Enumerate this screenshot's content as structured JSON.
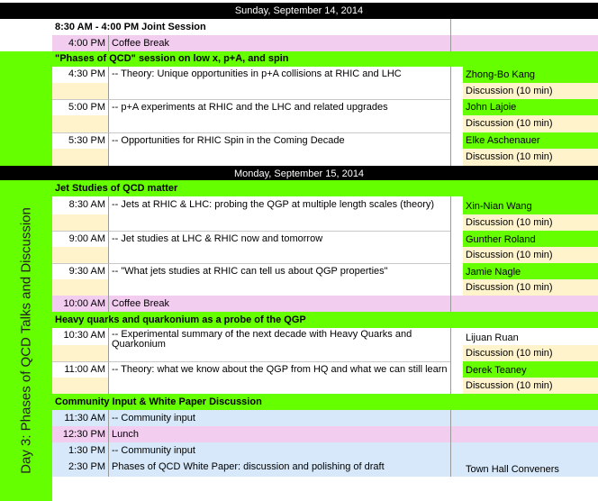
{
  "day1": {
    "header": "Sunday, September 14, 2014",
    "joint_session": "8:30 AM - 4:00 PM Joint Session",
    "break_time": "4:00 PM",
    "break_label": "Coffee Break",
    "session_title": "\"Phases of QCD\" session on low x, p+A, and spin",
    "talks": [
      {
        "time": "4:30 PM",
        "title": "-- Theory: Unique opportunities in p+A collisions at RHIC and LHC",
        "speaker": "Zhong-Bo Kang",
        "discussion": "Discussion (10 min)"
      },
      {
        "time": "5:00 PM",
        "title": "-- p+A experiments at RHIC and the LHC and related upgrades",
        "speaker": "John Lajoie",
        "discussion": "Discussion (10 min)"
      },
      {
        "time": "5:30 PM",
        "title": "-- Opportunities for RHIC Spin in the Coming Decade",
        "speaker": "Elke Aschenauer",
        "discussion": "Discussion (10 min)"
      }
    ]
  },
  "day2": {
    "header": "Monday, September 15, 2014",
    "side_label": "Day 3: Phases of QCD Talks and Discussion",
    "jet_session": "Jet Studies of QCD matter",
    "jet_talks": [
      {
        "time": "8:30 AM",
        "title": "-- Jets at RHIC & LHC: probing the QGP at multiple length scales (theory)",
        "speaker": "Xin-Nian Wang",
        "discussion": "Discussion (10 min)"
      },
      {
        "time": "9:00 AM",
        "title": "-- Jet studies at LHC & RHIC now and tomorrow",
        "speaker": "Gunther Roland",
        "discussion": "Discussion (10 min)"
      },
      {
        "time": "9:30 AM",
        "title": "-- \"What jets studies at RHIC can tell us about QGP properties\"",
        "speaker": "Jamie Nagle",
        "discussion": "Discussion (10 min)"
      }
    ],
    "break_time": "10:00 AM",
    "break_label": "Coffee Break",
    "hq_session": "Heavy quarks and quarkonium as a probe of the QGP",
    "hq_talks": [
      {
        "time": "10:30 AM",
        "title_line1": "-- Experimental summary of the next decade with Heavy Quarks and",
        "title_line2": "Quarkonium",
        "speaker": "Lijuan Ruan",
        "discussion": "Discussion (10 min)"
      },
      {
        "time": "11:00 AM",
        "title": "-- Theory: what we know about the QGP from HQ and what we can still learn",
        "speaker": "Derek Teaney",
        "discussion": "Discussion (10 min)"
      }
    ],
    "community_session": "Community Input & White Paper Discussion",
    "community": [
      {
        "time": "11:30 AM",
        "title": "-- Community input",
        "color": "blue",
        "speaker": ""
      },
      {
        "time": "12:30 PM",
        "title": "Lunch",
        "color": "pink",
        "speaker": ""
      },
      {
        "time": "1:30 PM",
        "title": "-- Community input",
        "color": "blue",
        "speaker": ""
      },
      {
        "time": "2:30 PM",
        "title": "Phases of QCD White Paper: discussion and polishing of draft",
        "color": "blue",
        "speaker": "Town Hall Conveners"
      }
    ]
  }
}
